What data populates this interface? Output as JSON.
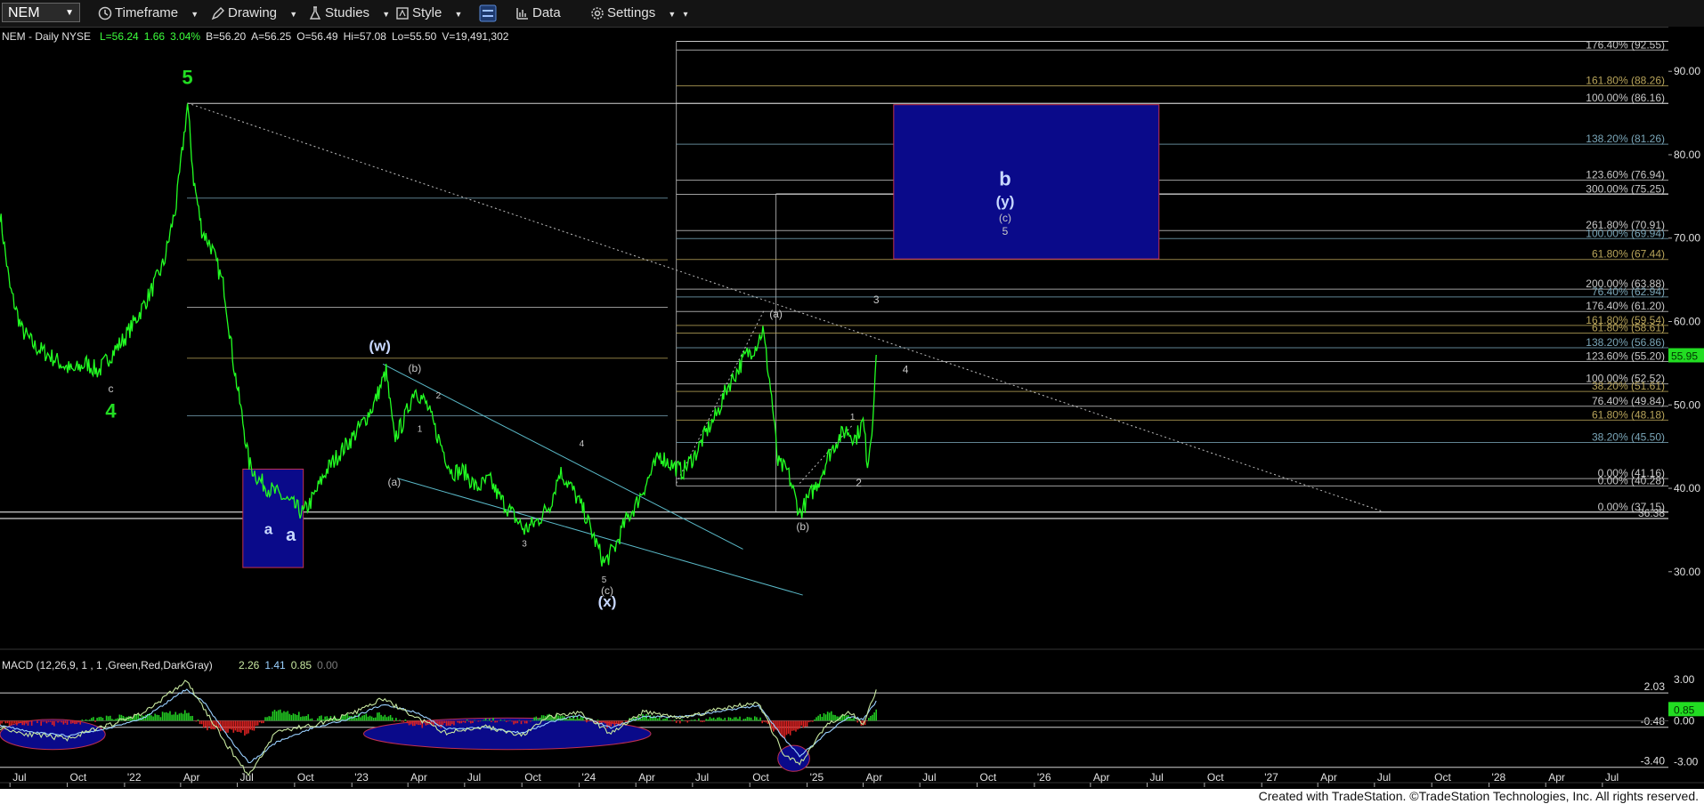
{
  "toolbar": {
    "symbol": "NEM",
    "items": [
      {
        "label": "Timeframe",
        "icon": "clock-icon"
      },
      {
        "label": "Drawing",
        "icon": "pencil-icon"
      },
      {
        "label": "Studies",
        "icon": "flask-icon"
      },
      {
        "label": "Style",
        "icon": "style-icon"
      },
      {
        "label": "",
        "icon": "layout-icon"
      },
      {
        "label": "Data",
        "icon": "bar-chart-icon"
      },
      {
        "label": "Settings",
        "icon": "gear-icon"
      }
    ]
  },
  "header": {
    "symbol_line": "NEM - Daily  NYSE",
    "quote": [
      {
        "text": "L=56.24",
        "color": "#3cff3c"
      },
      {
        "text": "1.66",
        "color": "#3cff3c"
      },
      {
        "text": "3.04%",
        "color": "#3cff3c"
      },
      {
        "text": "B=56.20",
        "color": "#e0e0e0"
      },
      {
        "text": "A=56.25",
        "color": "#e0e0e0"
      },
      {
        "text": "O=56.49",
        "color": "#e0e0e0"
      },
      {
        "text": "Hi=57.08",
        "color": "#e0e0e0"
      },
      {
        "text": "Lo=55.50",
        "color": "#e0e0e0"
      },
      {
        "text": "V=19,491,302",
        "color": "#e0e0e0"
      }
    ]
  },
  "colors": {
    "background": "#000000",
    "price_line": "#22ff22",
    "fib_gray": "#c8c8c8",
    "fib_olive": "#b8a45a",
    "channel": "#5ab9c8",
    "target_box": "#0a0a8a",
    "macd_line": "#c8e8a0",
    "signal_line": "#9ad0ff"
  },
  "chart_data": [
    {
      "type": "line",
      "title": "NEM - Daily",
      "y_range": [
        25.5,
        94.5
      ],
      "y_ticks": [
        "90.00",
        "80.00",
        "70.00",
        "60.00",
        "50.00",
        "40.00",
        "30.00"
      ],
      "y_tick_values": [
        90,
        80,
        70,
        60,
        50,
        40,
        30
      ],
      "x_range": [
        "2021-06-15",
        "2028-10-15"
      ],
      "x_tick_labels": [
        "Jul",
        "Oct",
        "'22",
        "Apr",
        "Jul",
        "Oct",
        "'23",
        "Apr",
        "Jul",
        "Oct",
        "'24",
        "Apr",
        "Jul",
        "Oct",
        "'25",
        "Apr",
        "Jul",
        "Oct",
        "'26",
        "Apr",
        "Jul",
        "Oct",
        "'27",
        "Apr",
        "Jul",
        "Oct",
        "'28",
        "Apr",
        "Jul"
      ],
      "x_tick_dates": [
        "2021-07-01",
        "2021-10-01",
        "2022-01-01",
        "2022-04-01",
        "2022-07-01",
        "2022-10-01",
        "2023-01-01",
        "2023-04-01",
        "2023-07-01",
        "2023-10-01",
        "2024-01-01",
        "2024-04-01",
        "2024-07-01",
        "2024-10-01",
        "2025-01-01",
        "2025-04-01",
        "2025-07-01",
        "2025-10-01",
        "2026-01-01",
        "2026-04-01",
        "2026-07-01",
        "2026-10-01",
        "2027-01-01",
        "2027-04-01",
        "2027-07-01",
        "2027-10-01",
        "2028-01-01",
        "2028-04-01",
        "2028-07-01"
      ],
      "last_price": "55.95",
      "series": [
        {
          "x": [
            "2021-06-15",
            "2021-07-01",
            "2021-07-20",
            "2021-08-10",
            "2021-09-01",
            "2021-09-20",
            "2021-10-10",
            "2021-11-01",
            "2021-11-20",
            "2021-12-10",
            "2022-01-01",
            "2022-01-25",
            "2022-02-15",
            "2022-03-05",
            "2022-03-25",
            "2022-04-12",
            "2022-04-22",
            "2022-05-05",
            "2022-05-20",
            "2022-06-10",
            "2022-06-25",
            "2022-07-10",
            "2022-07-20",
            "2022-08-05",
            "2022-08-20",
            "2022-09-10",
            "2022-09-28",
            "2022-10-15",
            "2022-11-01",
            "2022-11-20",
            "2022-12-10",
            "2023-01-01",
            "2023-01-20",
            "2023-02-05",
            "2023-02-25",
            "2023-03-10",
            "2023-03-25",
            "2023-04-12",
            "2023-05-01",
            "2023-05-20",
            "2023-06-10",
            "2023-07-01",
            "2023-07-20",
            "2023-08-10",
            "2023-08-25",
            "2023-09-15",
            "2023-10-05",
            "2023-10-25",
            "2023-11-15",
            "2023-12-01",
            "2023-12-20",
            "2024-01-10",
            "2024-01-25",
            "2024-02-10",
            "2024-02-28",
            "2024-03-15",
            "2024-04-01",
            "2024-04-20",
            "2024-05-10",
            "2024-05-25",
            "2024-06-15",
            "2024-07-05",
            "2024-07-25",
            "2024-08-10",
            "2024-08-25",
            "2024-09-10",
            "2024-09-25",
            "2024-10-10",
            "2024-10-22",
            "2024-11-05",
            "2024-11-15",
            "2024-12-01",
            "2024-12-20",
            "2025-01-05",
            "2025-01-20",
            "2025-02-05",
            "2025-02-20",
            "2025-03-05",
            "2025-03-20",
            "2025-04-01",
            "2025-04-08",
            "2025-04-15",
            "2025-04-22"
          ],
          "y": [
            73,
            64,
            59,
            57,
            56,
            55,
            54,
            55,
            54,
            56,
            58,
            61,
            64,
            67,
            74,
            86,
            77,
            71,
            69,
            64,
            55,
            48,
            43,
            41,
            40,
            39,
            38,
            37,
            39,
            42,
            44,
            46,
            48,
            50,
            54,
            46,
            48,
            52,
            50,
            46,
            42,
            42,
            40,
            41,
            39,
            37,
            35,
            36,
            38,
            42,
            40,
            37,
            34,
            31,
            33,
            36,
            38,
            41,
            44,
            43,
            42,
            44,
            47,
            49,
            52,
            54,
            56,
            57,
            59,
            51,
            43,
            42,
            37,
            39,
            41,
            44,
            46,
            47,
            46,
            48,
            43,
            47,
            56
          ]
        }
      ],
      "fib_levels_right": [
        {
          "label": "176.40% (92.55)",
          "value": 92.55,
          "color": "#c8c8c8"
        },
        {
          "label": "161.80% (88.26)",
          "value": 88.26,
          "color": "#b8a45a"
        },
        {
          "label": "100.00% (86.16)",
          "value": 86.16,
          "color": "#c8c8c8"
        },
        {
          "label": "138.20% (81.26)",
          "value": 81.26,
          "color": "#7aa6b8"
        },
        {
          "label": "123.60% (76.94)",
          "value": 76.94,
          "color": "#c8c8c8"
        },
        {
          "label": "300.00% (75.25)",
          "value": 75.25,
          "color": "#c8c8c8"
        },
        {
          "label": "261.80% (70.91)",
          "value": 70.91,
          "color": "#c8c8c8"
        },
        {
          "label": "100.00% (69.94)",
          "value": 69.94,
          "color": "#7aa6b8"
        },
        {
          "label": "61.80% (67.44)",
          "value": 67.44,
          "color": "#b8a45a"
        },
        {
          "label": "200.00% (63.88)",
          "value": 63.88,
          "color": "#c8c8c8"
        },
        {
          "label": "76.40% (62.94)",
          "value": 62.94,
          "color": "#7aa6b8"
        },
        {
          "label": "176.40% (61.20)",
          "value": 61.2,
          "color": "#c8c8c8"
        },
        {
          "label": "161.80% (59.54)",
          "value": 59.54,
          "color": "#b8a45a"
        },
        {
          "label": "61.80% (58.61)",
          "value": 58.61,
          "color": "#b8a45a"
        },
        {
          "label": "138.20% (56.86)",
          "value": 56.86,
          "color": "#7aa6b8"
        },
        {
          "label": "123.60% (55.20)",
          "value": 55.2,
          "color": "#c8c8c8"
        },
        {
          "label": "100.00% (52.52)",
          "value": 52.52,
          "color": "#c8c8c8"
        },
        {
          "label": "38.20% (51.61)",
          "value": 51.61,
          "color": "#b8a45a"
        },
        {
          "label": "76.40% (49.84)",
          "value": 49.84,
          "color": "#c8c8c8"
        },
        {
          "label": "61.80% (48.18)",
          "value": 48.18,
          "color": "#b8a45a"
        },
        {
          "label": "38.20% (45.50)",
          "value": 45.5,
          "color": "#7aa6b8"
        },
        {
          "label": "0.00% (41.16)",
          "value": 41.16,
          "color": "#c8c8c8"
        },
        {
          "label": "0.00% (40.28)",
          "value": 40.28,
          "color": "#c8c8c8"
        },
        {
          "label": "0.00% (37.15)",
          "value": 37.15,
          "color": "#c8c8c8"
        },
        {
          "label": "36.38",
          "value": 36.38,
          "color": "#c8c8c8"
        }
      ],
      "fib_levels_left": [
        {
          "value": 74.8,
          "color": "#7aa6b8"
        },
        {
          "value": 67.4,
          "color": "#b8a45a"
        },
        {
          "value": 61.7,
          "color": "#c8c8c8"
        },
        {
          "value": 55.6,
          "color": "#b8a45a"
        },
        {
          "value": 48.7,
          "color": "#7aa6b8"
        }
      ],
      "boxes": [
        {
          "x0": "2022-07-10",
          "x1": "2022-10-15",
          "y0": 30.5,
          "y1": 42.3,
          "label": "a"
        },
        {
          "x0": "2025-05-20",
          "x1": "2026-07-20",
          "y0": 67.5,
          "y1": 86.0,
          "label": ""
        }
      ],
      "wave_labels": [
        {
          "text": "5",
          "x": "2022-04-12",
          "y": 88.5,
          "color": "#22dd22",
          "size": "large"
        },
        {
          "text": "c",
          "x": "2021-12-10",
          "y": 51.5,
          "color": "#c8c8c8",
          "size": "small"
        },
        {
          "text": "4",
          "x": "2021-12-10",
          "y": 48.5,
          "color": "#22dd22",
          "size": "large"
        },
        {
          "text": "a",
          "x": "2022-08-20",
          "y": 34.5,
          "color": "#c8d8ff",
          "size": "medium"
        },
        {
          "text": "(w)",
          "x": "2023-02-15",
          "y": 56.5,
          "color": "#c8d8ff",
          "size": "medium"
        },
        {
          "text": "(b)",
          "x": "2023-04-12",
          "y": 54.0,
          "color": "#c8c8c8",
          "size": "small"
        },
        {
          "text": "2",
          "x": "2023-05-20",
          "y": 50.8,
          "color": "#c8c8c8",
          "size": "xsmall"
        },
        {
          "text": "1",
          "x": "2023-04-20",
          "y": 46.8,
          "color": "#c8c8c8",
          "size": "xsmall"
        },
        {
          "text": "(a)",
          "x": "2023-03-10",
          "y": 40.3,
          "color": "#c8c8c8",
          "size": "small"
        },
        {
          "text": "3",
          "x": "2023-10-05",
          "y": 33.0,
          "color": "#c8c8c8",
          "size": "xsmall"
        },
        {
          "text": "4",
          "x": "2024-01-05",
          "y": 45.0,
          "color": "#c8c8c8",
          "size": "xsmall"
        },
        {
          "text": "5",
          "x": "2024-02-10",
          "y": 28.7,
          "color": "#c8c8c8",
          "size": "xsmall"
        },
        {
          "text": "(c)",
          "x": "2024-02-15",
          "y": 27.3,
          "color": "#c8c8c8",
          "size": "small"
        },
        {
          "text": "(x)",
          "x": "2024-02-15",
          "y": 25.8,
          "color": "#c8d8ff",
          "size": "medium"
        },
        {
          "text": "(a)",
          "x": "2024-11-12",
          "y": 60.5,
          "color": "#c8c8c8",
          "size": "small"
        },
        {
          "text": "(b)",
          "x": "2024-12-25",
          "y": 35.0,
          "color": "#c8c8c8",
          "size": "small"
        },
        {
          "text": "1",
          "x": "2025-03-15",
          "y": 48.2,
          "color": "#c8c8c8",
          "size": "xsmall"
        },
        {
          "text": "2",
          "x": "2025-03-25",
          "y": 40.2,
          "color": "#c8c8c8",
          "size": "small"
        },
        {
          "text": "3",
          "x": "2025-04-22",
          "y": 62.2,
          "color": "#c8c8c8",
          "size": "small"
        },
        {
          "text": "4",
          "x": "2025-06-08",
          "y": 53.8,
          "color": "#c8c8c8",
          "size": "small"
        },
        {
          "text": "b",
          "x": "2025-11-15",
          "y": 76.3,
          "color": "#c8d8ff",
          "size": "large"
        },
        {
          "text": "(y)",
          "x": "2025-11-15",
          "y": 73.8,
          "color": "#c8d8ff",
          "size": "medium"
        },
        {
          "text": "(c)",
          "x": "2025-11-15",
          "y": 72.0,
          "color": "#c8c8c8",
          "size": "small"
        },
        {
          "text": "5",
          "x": "2025-11-15",
          "y": 70.4,
          "color": "#c8c8c8",
          "size": "small"
        }
      ]
    },
    {
      "type": "line",
      "title": "MACD (12,26,9, 1 , 1 ,Green,Red,DarkGray)",
      "legend_values": [
        {
          "text": "2.26",
          "color": "#c8e8a0"
        },
        {
          "text": "1.41",
          "color": "#9ad0ff"
        },
        {
          "text": "0.85",
          "color": "#c8e8a0"
        },
        {
          "text": "0.00",
          "color": "#7a7a7a"
        }
      ],
      "y_range": [
        -4.2,
        3.6
      ],
      "y_ticks": [
        "3.00",
        "0.00",
        "-3.00"
      ],
      "y_tick_values": [
        3,
        0,
        -3
      ],
      "ref_levels": [
        {
          "label": "2.03",
          "value": 2.03
        },
        {
          "label": "-0.48",
          "value": -0.48
        },
        {
          "label": "-3.40",
          "value": -3.4
        }
      ],
      "last_value": "0.85",
      "series": [
        {
          "name": "MACD",
          "x": [
            "2021-06-15",
            "2021-08-01",
            "2021-10-01",
            "2021-12-01",
            "2022-02-01",
            "2022-04-10",
            "2022-05-10",
            "2022-06-10",
            "2022-07-20",
            "2022-09-01",
            "2022-11-01",
            "2023-01-01",
            "2023-02-20",
            "2023-04-15",
            "2023-06-01",
            "2023-08-01",
            "2023-10-01",
            "2023-11-15",
            "2024-01-01",
            "2024-02-20",
            "2024-04-15",
            "2024-06-15",
            "2024-08-15",
            "2024-10-15",
            "2024-11-25",
            "2024-12-20",
            "2025-02-01",
            "2025-03-10",
            "2025-04-01",
            "2025-04-22"
          ],
          "y": [
            -0.5,
            -1.0,
            -1.3,
            -0.4,
            0.6,
            2.9,
            0.8,
            -1.5,
            -4.0,
            -0.8,
            -0.3,
            0.5,
            1.6,
            0.2,
            -0.9,
            -0.4,
            -1.1,
            0.3,
            0.6,
            -0.9,
            0.7,
            0.2,
            0.9,
            1.3,
            -2.5,
            -3.2,
            -0.3,
            0.7,
            -0.2,
            2.26
          ]
        },
        {
          "name": "Signal",
          "x": [
            "2021-06-15",
            "2021-08-01",
            "2021-10-01",
            "2021-12-01",
            "2022-02-01",
            "2022-04-10",
            "2022-05-10",
            "2022-06-10",
            "2022-07-20",
            "2022-09-01",
            "2022-11-01",
            "2023-01-01",
            "2023-02-20",
            "2023-04-15",
            "2023-06-01",
            "2023-08-01",
            "2023-10-01",
            "2023-11-15",
            "2024-01-01",
            "2024-02-20",
            "2024-04-15",
            "2024-06-15",
            "2024-08-15",
            "2024-10-15",
            "2024-11-25",
            "2024-12-20",
            "2025-02-01",
            "2025-03-10",
            "2025-04-01",
            "2025-04-22"
          ],
          "y": [
            -0.3,
            -0.8,
            -1.1,
            -0.6,
            0.2,
            2.3,
            1.3,
            -0.8,
            -3.1,
            -1.6,
            -0.5,
            0.2,
            1.2,
            0.6,
            -0.6,
            -0.5,
            -0.9,
            -0.1,
            0.4,
            -0.5,
            0.3,
            0.3,
            0.7,
            1.1,
            -1.3,
            -2.6,
            -0.9,
            0.3,
            0.1,
            1.41
          ]
        }
      ],
      "highlight_ellipses": [
        {
          "x0": "2021-06-15",
          "x1": "2021-12-01",
          "y0": -2.1,
          "y1": 0.1
        },
        {
          "x0": "2023-01-20",
          "x1": "2024-04-25",
          "y0": -2.1,
          "y1": 0.2
        },
        {
          "x0": "2024-11-15",
          "x1": "2025-01-05",
          "y0": -3.7,
          "y1": -1.8
        }
      ]
    }
  ],
  "footer": {
    "credit": "Created with TradeStation. ©TradeStation Technologies, Inc. All rights reserved."
  }
}
